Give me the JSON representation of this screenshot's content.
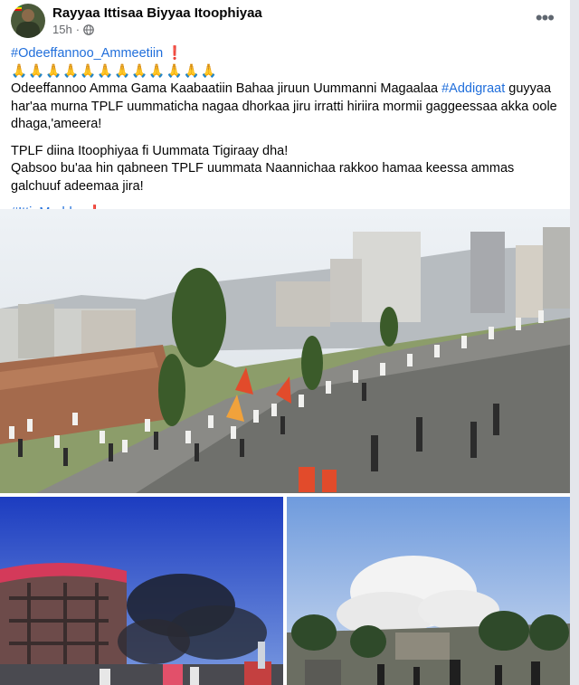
{
  "post": {
    "page_name": "Rayyaa Ittisaa Biyyaa Itoophiyaa",
    "time": "15h",
    "hashtag_top": "#Odeeffannoo_Ammeetiin",
    "exclamation": "❗",
    "praying_hands": "🙏🙏🙏🙏🙏🙏🙏🙏🙏🙏🙏🙏",
    "para1_before": "Odeeffannoo Amma Gama Kaabaatiin Bahaa jiruun Uummanni Magaalaa ",
    "para1_tag": "#Addigraat",
    "para1_after": " guyyaa har'aa murna TPLF uummaticha nagaa dhorkaa jiru irratti hiriira mormii gaggeessaa akka oole dhaga,'ameera!",
    "para2_line1": "TPLF diina Itoophiyaa fi Uummata Tigiraay dha!",
    "para2_line2": "Qabsoo bu'aa hin qabneen TPLF uummata Naannichaa rakkoo hamaa keessa ammas galchuuf adeemaa jira!",
    "hashtag_bottom": "#Itti_Muddaa",
    "more_icon": "•••"
  },
  "colors": {
    "link_blue": "#216fdb",
    "text": "#050505",
    "meta_gray": "#65676b"
  },
  "icons": [
    "globe-icon",
    "more-options-icon"
  ]
}
